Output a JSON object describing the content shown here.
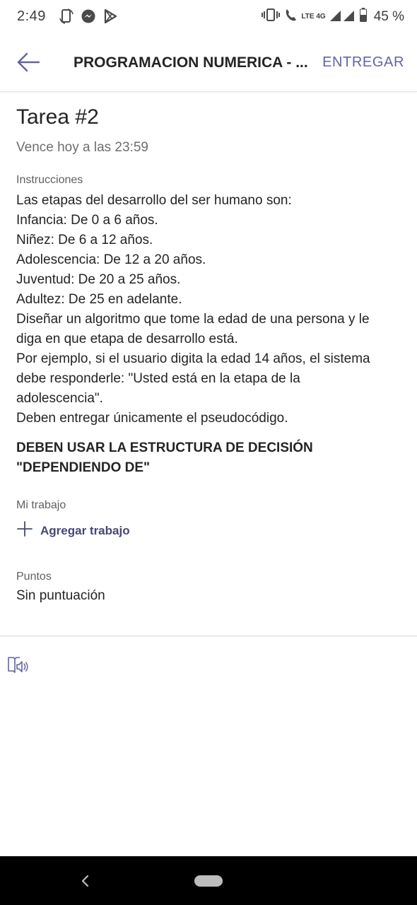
{
  "status_bar": {
    "time": "2:49",
    "network": "LTE 4G",
    "battery": "45 %",
    "icons": [
      "screen-rotate-icon",
      "messenger-icon",
      "play-store-icon",
      "vibrate-icon",
      "wifi-calling-icon",
      "signal-icon",
      "battery-icon"
    ]
  },
  "app_bar": {
    "title": "PROGRAMACION NUMERICA - ...",
    "action": "ENTREGAR",
    "back_icon": "arrow-left-icon",
    "accent_color": "#6264a7"
  },
  "assignment": {
    "title": "Tarea #2",
    "due": "Vence hoy a las 23:59",
    "instructions_label": "Instrucciones",
    "instructions": [
      "Las etapas del desarrollo del ser humano son:",
      "Infancia: De 0 a 6 años.",
      "Niñez: De 6 a 12 años.",
      "Adolescencia: De 12 a 20 años.",
      "Juventud: De 20 a 25 años.",
      "Adultez: De 25 en adelante.",
      "Diseñar un algoritmo que tome la edad de una persona y le",
      "diga en que etapa de desarrollo está.",
      "Por ejemplo, si el usuario digita la edad 14 años, el sistema",
      "debe responderle: \"Usted está en la etapa de la",
      "adolescencia\".",
      "Deben entregar únicamente el pseudocódigo."
    ],
    "instructions_bold": [
      "DEBEN USAR LA ESTRUCTURA DE DECISIÓN",
      "\"DEPENDIENDO DE\""
    ],
    "my_work_label": "Mi trabajo",
    "add_work_label": "Agregar trabajo",
    "points_label": "Puntos",
    "points_value": "Sin puntuación"
  },
  "footer": {
    "immersive_reader_icon": "immersive-reader-icon"
  },
  "nav_bar": {
    "icons": [
      "nav-back-icon",
      "nav-home-pill"
    ]
  }
}
